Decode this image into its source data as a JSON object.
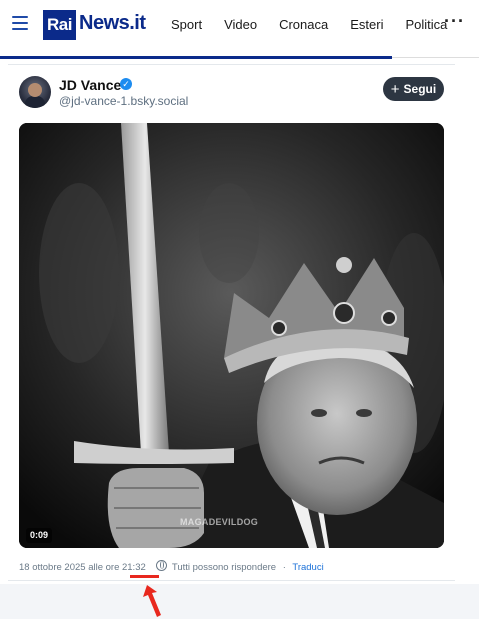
{
  "header": {
    "logo_rai": "Rai",
    "logo_news": "News.it",
    "nav_items": [
      "Sport",
      "Video",
      "Cronaca",
      "Esteri",
      "Politica"
    ],
    "more": "···"
  },
  "post": {
    "author_name": "JD Vance",
    "handle": "@jd-vance-1.bsky.social",
    "follow_label": "Segui",
    "media": {
      "duration": "0:09",
      "watermark": "MAGADEVILDOG"
    },
    "meta": {
      "datetime": "18 ottobre 2025 alle ore 21:32",
      "replies": "Tutti possono rispondere",
      "separator": "·",
      "translate": "Traduci"
    }
  },
  "colors": {
    "brand": "#0b2a8a",
    "verified": "#1d8cf0",
    "annotation": "#e8281e",
    "link": "#1d72d8"
  }
}
